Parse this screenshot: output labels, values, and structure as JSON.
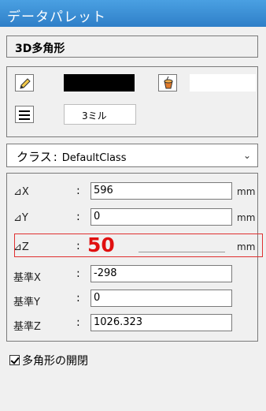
{
  "palette": {
    "title": "データパレット",
    "object_type": "3D多角形"
  },
  "attributes": {
    "pen_color": "#000000",
    "fill_color": "#ffffff",
    "line_weight": "3ミル"
  },
  "class_select": {
    "label": "クラス",
    "colon": ":",
    "value": "DefaultClass"
  },
  "fields": [
    {
      "label": "⊿X",
      "value": "596",
      "unit": "mm"
    },
    {
      "label": "⊿Y",
      "value": "0",
      "unit": "mm"
    },
    {
      "label": "⊿Z",
      "value": "50",
      "unit": "mm"
    },
    {
      "label": "基準X",
      "value": "-298",
      "unit": ""
    },
    {
      "label": "基準Y",
      "value": "0",
      "unit": ""
    },
    {
      "label": "基準Z",
      "value": "1026.323",
      "unit": ""
    }
  ],
  "colon": ":",
  "checkbox": {
    "label": "多角形の開閉",
    "checked": true
  }
}
